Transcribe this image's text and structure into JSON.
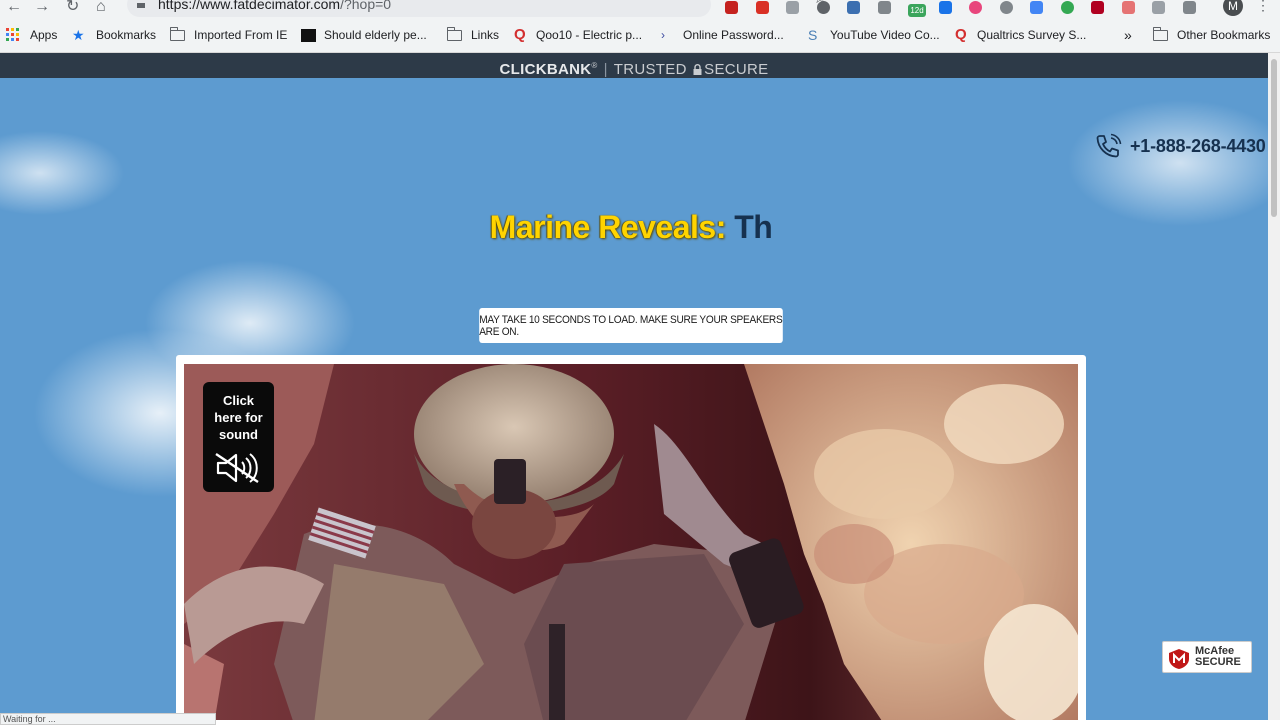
{
  "browser": {
    "url_host": "https://www.fatdecimator.com",
    "url_path": "/?hop=0",
    "profile_initial": "M",
    "bookmarks": [
      {
        "label": "Apps",
        "icon": "apps-grid-icon"
      },
      {
        "label": "Bookmarks",
        "icon": "star-icon"
      },
      {
        "label": "Imported From IE",
        "icon": "folder-icon"
      },
      {
        "label": "Should elderly pe...",
        "icon": "site-favicon"
      },
      {
        "label": "Links",
        "icon": "folder-icon"
      },
      {
        "label": "Qoo10 - Electric p...",
        "icon": "qoo10-icon"
      },
      {
        "label": "Online Password...",
        "icon": "site-favicon"
      },
      {
        "label": "YouTube Video Co...",
        "icon": "site-favicon"
      },
      {
        "label": "Qualtrics Survey S...",
        "icon": "qualtrics-icon"
      }
    ],
    "overflow": "»",
    "other_bookmarks": "Other Bookmarks",
    "extension_badge": "12d"
  },
  "page": {
    "clickbank_brand": "CLICKBANK",
    "clickbank_reg": "®",
    "clickbank_tagline": "TRUSTED",
    "clickbank_secure": "SECURE",
    "phone_number": "+1-888-268-4430",
    "headline_part1": "Marine Reveals:",
    "headline_part2": "Th",
    "load_notice": "MAY TAKE 10 SECONDS TO LOAD. MAKE SURE YOUR SPEAKERS ARE ON.",
    "sound_button": "Click here for sound",
    "mcafee_line1": "McAfee",
    "mcafee_line2": "SECURE",
    "status_text": "Waiting for ..."
  },
  "colors": {
    "sky": "#5d9bd0",
    "clickbank_bar": "#2d3a48",
    "headline_yellow": "#ffd400",
    "headline_navy": "#16314f"
  }
}
